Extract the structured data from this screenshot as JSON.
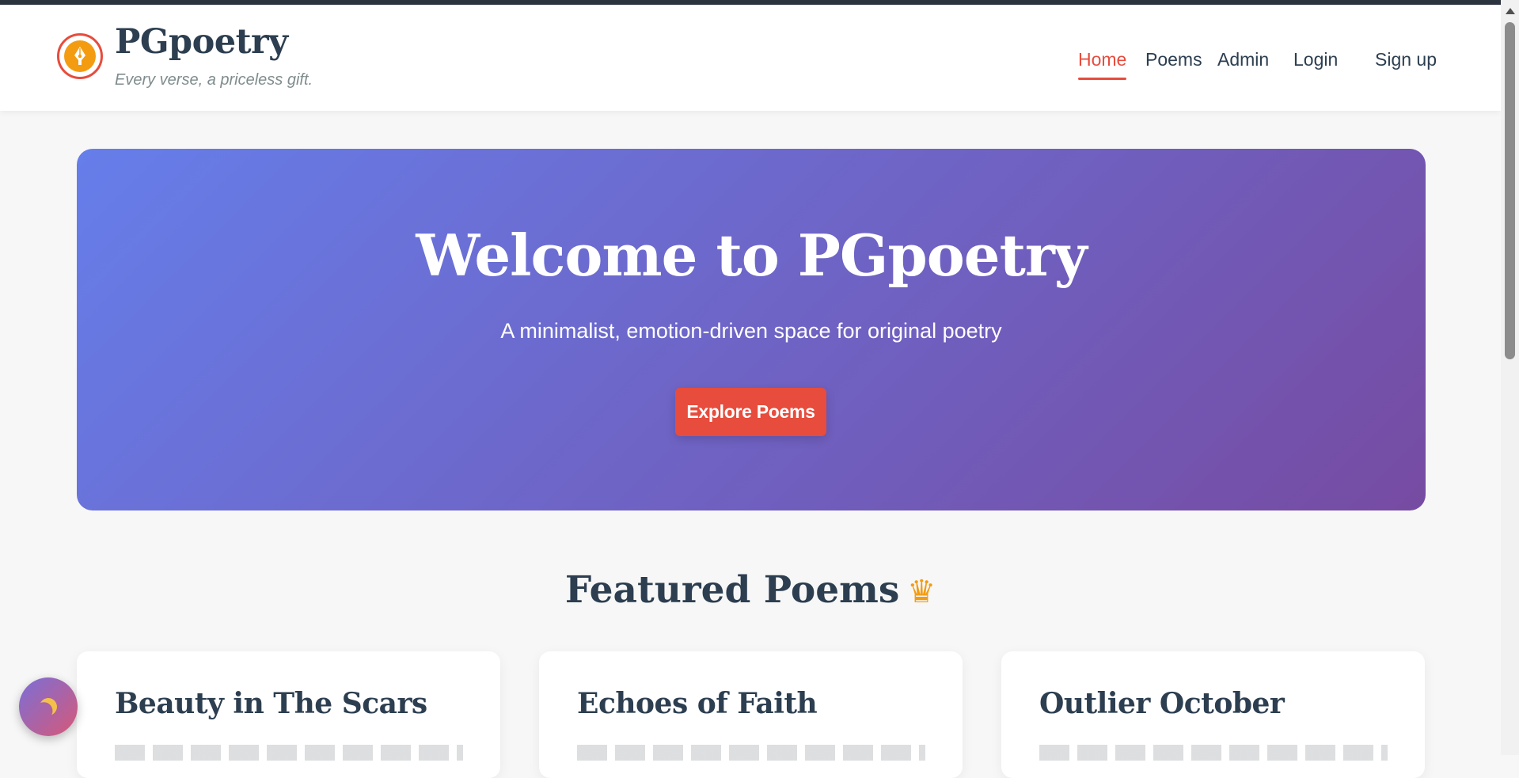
{
  "header": {
    "brand_name": "PGpoetry",
    "tagline": "Every verse, a priceless gift.",
    "logo_icon": "pen-nib-icon",
    "nav": [
      {
        "label": "Home",
        "active": true
      },
      {
        "label": "Poems",
        "active": false
      },
      {
        "label": "Admin",
        "active": false
      },
      {
        "label": "Login",
        "active": false
      },
      {
        "label": "Sign up",
        "active": false
      }
    ]
  },
  "hero": {
    "title": "Welcome to PGpoetry",
    "subtitle": "A minimalist, emotion-driven space for original poetry",
    "button_label": "Explore Poems"
  },
  "featured": {
    "heading": "Featured Poems",
    "heading_icon": "crown-icon",
    "cards": [
      {
        "title": "Beauty in The Scars"
      },
      {
        "title": "Echoes of Faith"
      },
      {
        "title": "Outlier October"
      }
    ]
  },
  "theme_toggle": {
    "icon": "moon-icon"
  },
  "colors": {
    "accent": "#e74c3c",
    "hero_gradient_start": "#667eea",
    "hero_gradient_end": "#764ba2",
    "text_primary": "#2c3e50",
    "logo_gold": "#f39c12"
  }
}
